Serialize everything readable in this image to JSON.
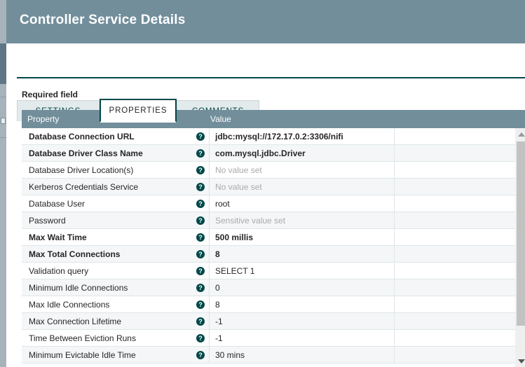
{
  "dialog": {
    "title": "Controller Service Details",
    "title_bar_color": "#728e9b"
  },
  "tabs": [
    {
      "id": "settings",
      "label": "SETTINGS",
      "active": false
    },
    {
      "id": "properties",
      "label": "PROPERTIES",
      "active": true
    },
    {
      "id": "comments",
      "label": "COMMENTS",
      "active": false
    }
  ],
  "notes": {
    "required_field": "Required field"
  },
  "table": {
    "columns": [
      "Property",
      "Value"
    ],
    "header_color": "#728e9b",
    "help_icon": "help-circle-icon",
    "rows": [
      {
        "property": "Database Connection URL",
        "value": "jdbc:mysql://172.17.0.2:3306/nifi",
        "required": true,
        "placeholder": false
      },
      {
        "property": "Database Driver Class Name",
        "value": "com.mysql.jdbc.Driver",
        "required": true,
        "placeholder": false
      },
      {
        "property": "Database Driver Location(s)",
        "value": "No value set",
        "required": false,
        "placeholder": true
      },
      {
        "property": "Kerberos Credentials Service",
        "value": "No value set",
        "required": false,
        "placeholder": true
      },
      {
        "property": "Database User",
        "value": "root",
        "required": false,
        "placeholder": false
      },
      {
        "property": "Password",
        "value": "Sensitive value set",
        "required": false,
        "placeholder": true
      },
      {
        "property": "Max Wait Time",
        "value": "500 millis",
        "required": true,
        "placeholder": false
      },
      {
        "property": "Max Total Connections",
        "value": "8",
        "required": true,
        "placeholder": false
      },
      {
        "property": "Validation query",
        "value": "SELECT 1",
        "required": false,
        "placeholder": false
      },
      {
        "property": "Minimum Idle Connections",
        "value": "0",
        "required": false,
        "placeholder": false
      },
      {
        "property": "Max Idle Connections",
        "value": "8",
        "required": false,
        "placeholder": false
      },
      {
        "property": "Max Connection Lifetime",
        "value": "-1",
        "required": false,
        "placeholder": false
      },
      {
        "property": "Time Between Eviction Runs",
        "value": "-1",
        "required": false,
        "placeholder": false
      },
      {
        "property": "Minimum Evictable Idle Time",
        "value": "30 mins",
        "required": false,
        "placeholder": false
      }
    ]
  },
  "scrollbar": {
    "up_icon": "scroll-up-arrow-icon",
    "down_icon": "scroll-down-arrow-icon"
  }
}
